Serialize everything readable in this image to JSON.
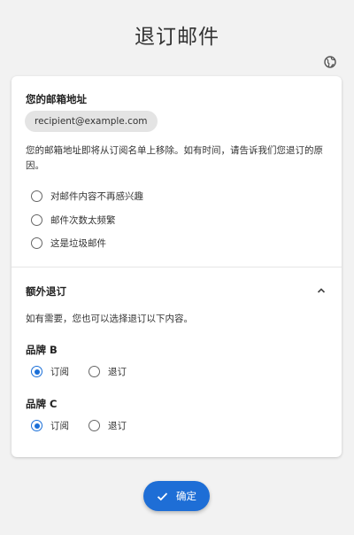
{
  "page": {
    "title": "退订邮件"
  },
  "account": {
    "heading": "您的邮箱地址",
    "email": "recipient@example.com",
    "notice": "您的邮箱地址即将从订阅名单上移除。如有时间，请告诉我们您退订的原因。",
    "reasons": [
      "对邮件内容不再感兴趣",
      "邮件次数太频繁",
      "这是垃圾邮件"
    ]
  },
  "extra": {
    "heading": "额外退订",
    "description": "如有需要，您也可以选择退订以下内容。",
    "brands": [
      {
        "name": "品牌 B",
        "subscribe_label": "订阅",
        "unsubscribe_label": "退订",
        "selected": "subscribe"
      },
      {
        "name": "品牌 C",
        "subscribe_label": "订阅",
        "unsubscribe_label": "退订",
        "selected": "subscribe"
      }
    ]
  },
  "actions": {
    "confirm_label": "确定"
  },
  "colors": {
    "accent": "#1e6ed6",
    "background": "#f2f2f2"
  },
  "icons": {
    "language": "globe-icon",
    "collapse": "chevron-up-icon",
    "confirm": "check-icon"
  }
}
